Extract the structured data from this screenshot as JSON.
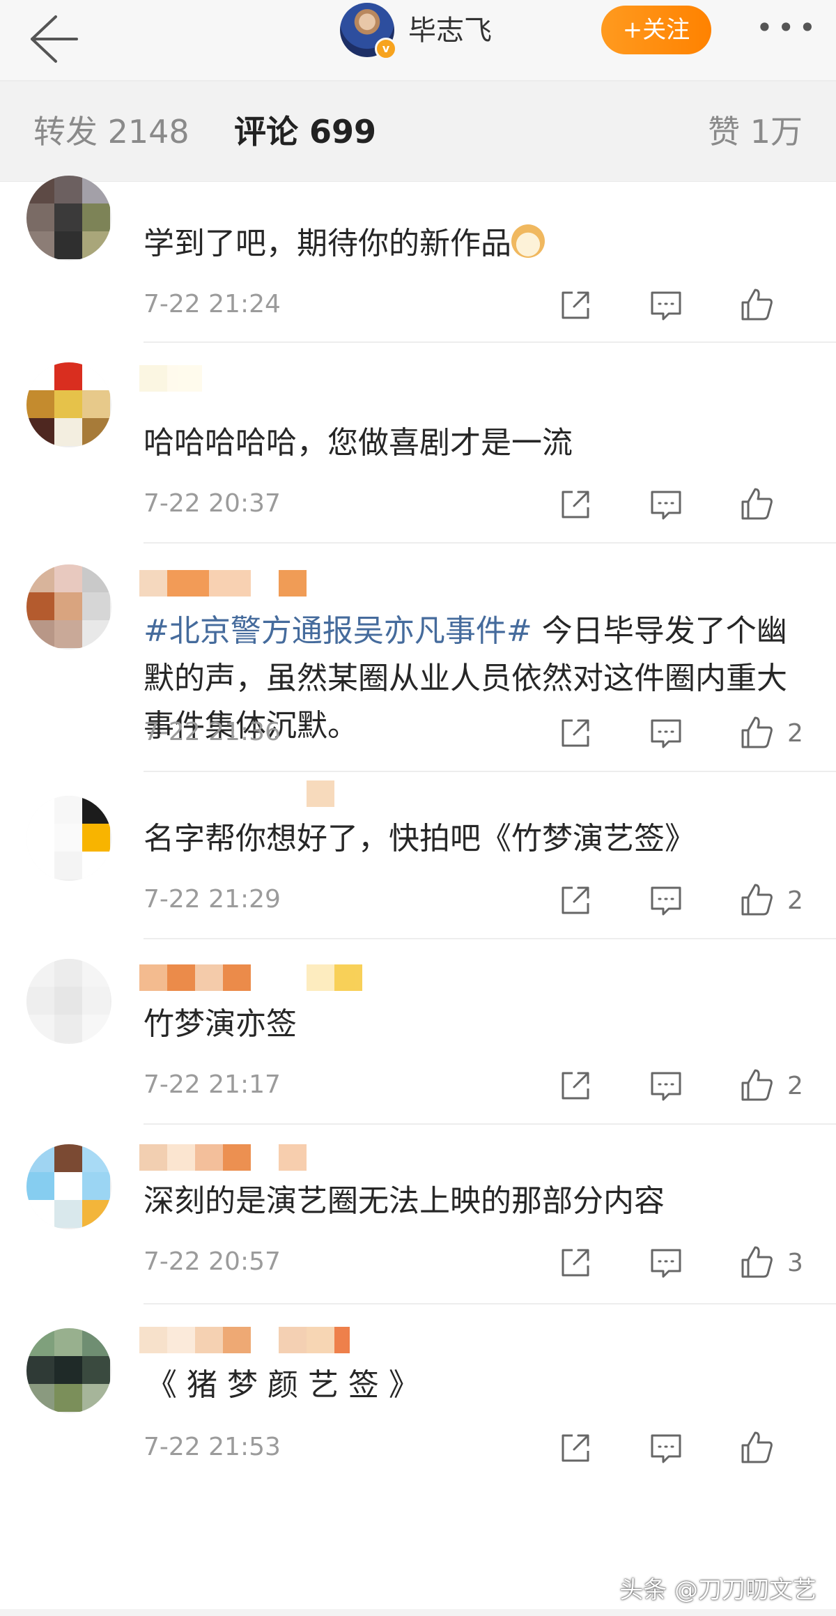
{
  "header": {
    "back_icon": "back-arrow-icon",
    "user_name": "毕志飞",
    "follow_label": "+关注",
    "more_label": "•••"
  },
  "tabs": {
    "repost": "转发 2148",
    "comments": "评论 699",
    "likes": "赞 1万"
  },
  "comments": [
    {
      "text": "学到了吧，期待你的新作品",
      "time": "7-22 21:24",
      "likes": ""
    },
    {
      "text": "哈哈哈哈哈，您做喜剧才是一流",
      "time": "7-22 20:37",
      "likes": ""
    },
    {
      "hashtag": "#北京警方通报吴亦凡事件#",
      "text": " 今日毕导发了个幽默的声，虽然某圈从业人员依然对这件圈内重大事件集体沉默。",
      "time": "7-22 21:36",
      "likes": "2"
    },
    {
      "text": "名字帮你想好了，快拍吧《竹梦演艺签》",
      "time": "7-22 21:29",
      "likes": "2"
    },
    {
      "text": "竹梦演亦签",
      "time": "7-22 21:17",
      "likes": "2"
    },
    {
      "text": "深刻的是演艺圈无法上映的那部分内容",
      "time": "7-22 20:57",
      "likes": "3"
    },
    {
      "text": "《 猪 梦 颜 艺 签 》",
      "time": "7-22 21:53",
      "likes": ""
    }
  ],
  "watermark": "头条 @刀刀叨文艺",
  "colors": {
    "accent_orange": "#ff8a00",
    "hashtag_blue": "#456b9c",
    "time_gray": "#9b9b9b"
  }
}
